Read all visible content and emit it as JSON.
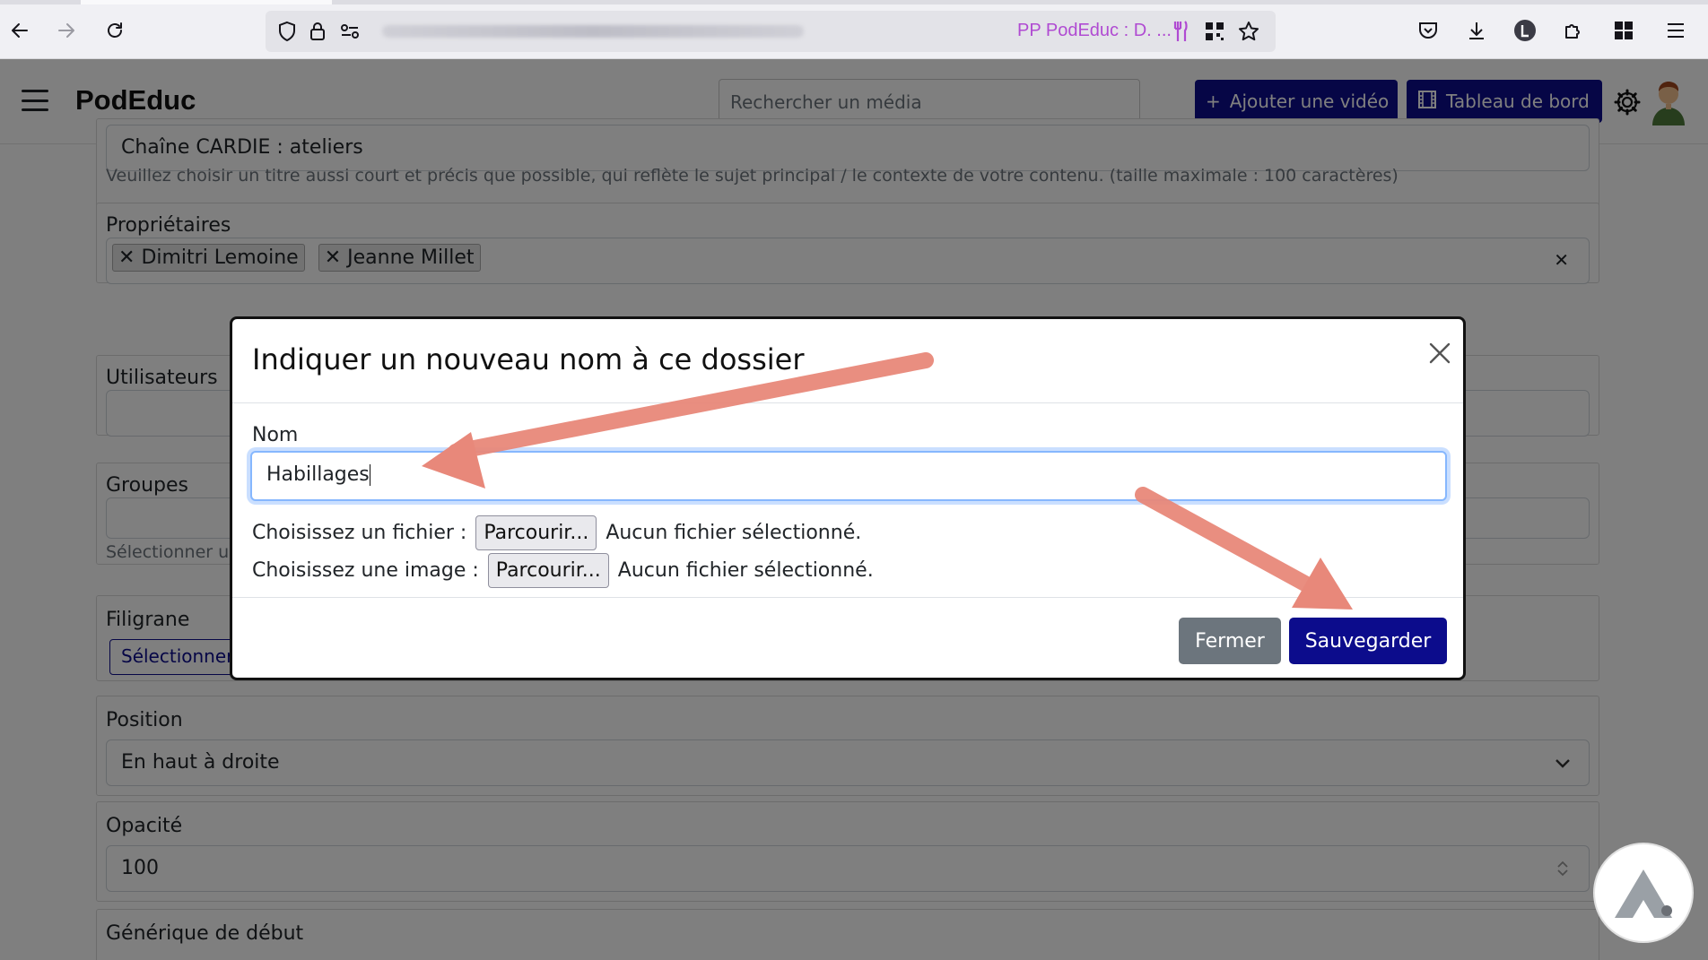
{
  "browser": {
    "url_suggestion": "PP PodEduc : D. ..."
  },
  "app": {
    "brand": "PodEduc",
    "search_placeholder": "Rechercher un média",
    "add_video_label": "Ajouter une vidéo",
    "dashboard_label": "Tableau de bord"
  },
  "form": {
    "title_value": "Chaîne CARDIE : ateliers",
    "title_help": "Veuillez choisir un titre aussi court et précis que possible, qui reflète le sujet principal / le contexte de votre contenu. (taille maximale : 100 caractères)",
    "owners_label": "Propriétaires",
    "owners": [
      "Dimitri Lemoine",
      "Jeanne Millet"
    ],
    "users_label": "Utilisateurs",
    "groups_label": "Groupes",
    "groups_help": "Sélectionner u",
    "watermark_label": "Filigrane",
    "watermark_button": "Sélectionner",
    "position_label": "Position",
    "position_value": "En haut à droite",
    "opacity_label": "Opacité",
    "opacity_value": "100",
    "intro_label": "Générique de début"
  },
  "modal": {
    "title": "Indiquer un nouveau nom à ce dossier",
    "name_label": "Nom",
    "name_value": "Habillages",
    "file_label": "Choisissez un fichier :",
    "image_label": "Choisissez une image :",
    "browse_label": "Parcourir...",
    "no_file_text": "Aucun fichier sélectionné.",
    "close_button": "Fermer",
    "save_button": "Sauvegarder"
  },
  "icons": {
    "close": "close-icon",
    "gear": "gear-icon",
    "plus": "plus-icon",
    "film": "film-icon",
    "chevron": "chevron-down-icon"
  },
  "colors": {
    "primary": "#0c0c8c",
    "secondary": "#6c757d",
    "annotation_arrow": "#e8887a",
    "url_suggestion": "#b04bd2"
  }
}
